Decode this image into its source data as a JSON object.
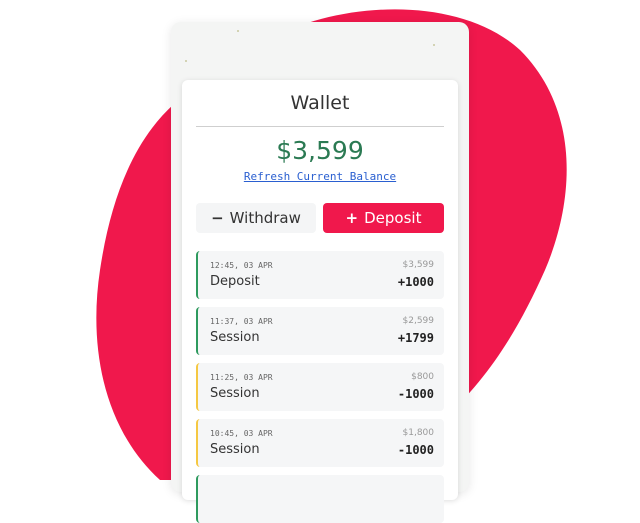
{
  "colors": {
    "accent": "#f0184c",
    "balance": "#2b7a53",
    "positive_border": "#2e9a5e",
    "negative_border": "#f5c842",
    "link": "#2a5fd0"
  },
  "wallet": {
    "title": "Wallet",
    "balance": "$3,599",
    "refresh_label": "Refresh Current Balance"
  },
  "actions": {
    "withdraw_icon": "−",
    "withdraw_label": "Withdraw",
    "deposit_icon": "+",
    "deposit_label": "Deposit"
  },
  "transactions": [
    {
      "time": "12:45, 03 APR",
      "label": "Deposit",
      "balance": "$3,599",
      "amount": "+1000",
      "direction": "positive"
    },
    {
      "time": "11:37, 03 APR",
      "label": "Session",
      "balance": "$2,599",
      "amount": "+1799",
      "direction": "positive"
    },
    {
      "time": "11:25, 03 APR",
      "label": "Session",
      "balance": "$800",
      "amount": "-1000",
      "direction": "negative"
    },
    {
      "time": "10:45, 03 APR",
      "label": "Session",
      "balance": "$1,800",
      "amount": "-1000",
      "direction": "negative"
    }
  ]
}
